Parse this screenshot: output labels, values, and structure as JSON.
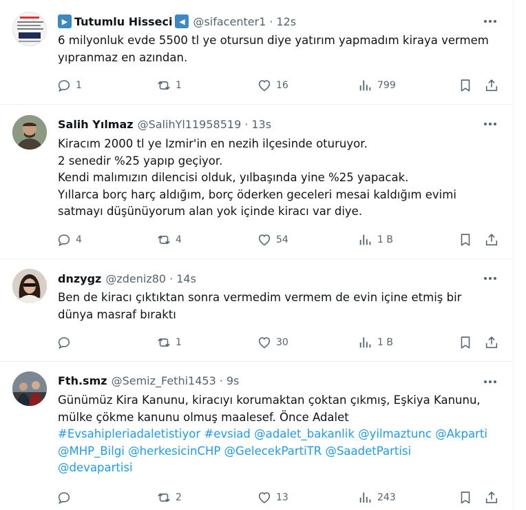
{
  "tweets": [
    {
      "name": "Tutumlu Hisseci",
      "handle": "@sifacenter1",
      "dot": "·",
      "time": "12s",
      "badge_left_color": "#3b88c3",
      "badge_right_color": "#3b88c3",
      "lines": [
        "6 milyonluk evde 5500 tl ye otursun diye yatırım yapmadım kiraya vermem",
        "yıpranmaz en azından."
      ],
      "replies": "1",
      "reposts": "1",
      "likes": "16",
      "views": "799"
    },
    {
      "name": "Salih Yılmaz",
      "handle": "@SalihYl11958519",
      "dot": "·",
      "time": "13s",
      "lines": [
        "Kiracım 2000 tl ye Izmir'in en nezih ilçesinde oturuyor.",
        "2 senedir %25 yapıp geçiyor.",
        "Kendi malımızın dilencisi olduk, yılbaşında yine %25 yapacak.",
        "Yıllarca borç harç aldığım, borç öderken geceleri mesai kaldığım evimi",
        "satmayı düşünüyorum alan yok içinde kiracı var diye."
      ],
      "replies": "4",
      "reposts": "4",
      "likes": "54",
      "views": "1 B"
    },
    {
      "name": "dnzygz",
      "handle": "@zdeniz80",
      "dot": "·",
      "time": "14s",
      "lines": [
        "Ben de kiracı çıktıktan sonra vermedim vermem de evin içine etmiş bir",
        "dünya masraf bıraktı"
      ],
      "replies": "",
      "reposts": "1",
      "likes": "30",
      "views": "1 B"
    },
    {
      "name": "Fth.smz",
      "handle": "@Semiz_Fethi1453",
      "dot": "·",
      "time": "9s",
      "lines": [
        "Günümüz Kira Kanunu, kiracıyı korumaktan çoktan çıkmış, Eşkiya Kanunu,",
        "mülke çökme kanunu olmuş maalesef. Önce Adalet"
      ],
      "hashtag_lines": [
        "#Evsahipleriadaletistiyor #evsiad @adalet_bakanlik @yilmaztunc @Akparti",
        "@MHP_Bilgi @herkesicinCHP @GelecekPartiTR @SaadetPartisi",
        "@devapartisi"
      ],
      "replies": "",
      "reposts": "2",
      "likes": "13",
      "views": "243"
    }
  ],
  "colors": {
    "text": "#0f1419",
    "muted": "#536471",
    "link": "#1d9bf0",
    "border": "#eff3f4"
  }
}
